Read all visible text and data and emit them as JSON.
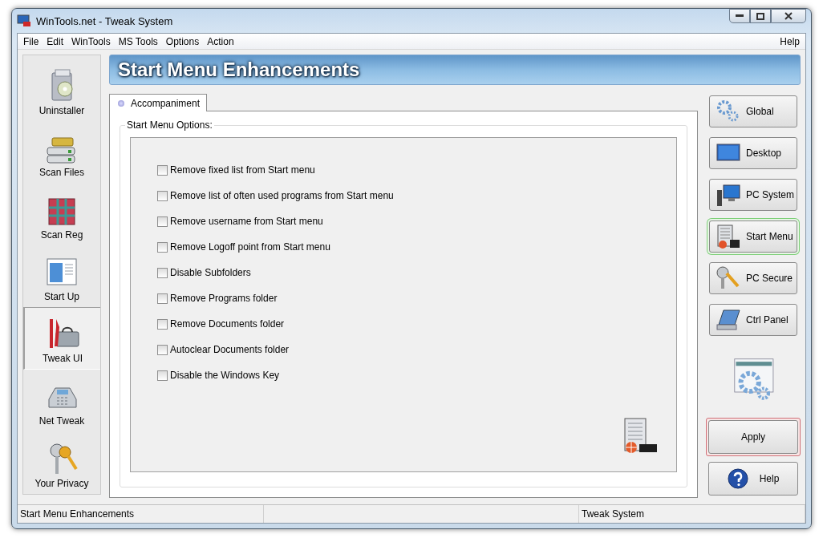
{
  "window": {
    "title": "WinTools.net - Tweak System"
  },
  "menu": [
    "File",
    "Edit",
    "WinTools",
    "MS Tools",
    "Options",
    "Action"
  ],
  "menu_right": "Help",
  "sidebar": [
    {
      "label": "Uninstaller",
      "selected": false
    },
    {
      "label": "Scan Files",
      "selected": false
    },
    {
      "label": "Scan Reg",
      "selected": false
    },
    {
      "label": "Start Up",
      "selected": false
    },
    {
      "label": "Tweak UI",
      "selected": true
    },
    {
      "label": "Net Tweak",
      "selected": false
    },
    {
      "label": "Your Privacy",
      "selected": false
    }
  ],
  "header": "Start Menu Enhancements",
  "tabs": [
    {
      "label": "Accompaniment",
      "selected": true
    }
  ],
  "group": {
    "title": "Start Menu Options:",
    "options": [
      {
        "label": "Remove fixed list from Start menu",
        "checked": false
      },
      {
        "label": "Remove list of often used programs from Start menu",
        "checked": false
      },
      {
        "label": "Remove username from Start menu",
        "checked": false
      },
      {
        "label": "Remove Logoff point from Start menu",
        "checked": false
      },
      {
        "label": "Disable Subfolders",
        "checked": false
      },
      {
        "label": "Remove Programs folder",
        "checked": false
      },
      {
        "label": "Remove Documents folder",
        "checked": false
      },
      {
        "label": "Autoclear Documents folder",
        "checked": false
      },
      {
        "label": "Disable the Windows Key",
        "checked": false
      }
    ]
  },
  "nav_buttons": [
    {
      "label": "Global",
      "selected": false
    },
    {
      "label": "Desktop",
      "selected": false
    },
    {
      "label": "PC System",
      "selected": false
    },
    {
      "label": "Start Menu",
      "selected": true
    },
    {
      "label": "PC Secure",
      "selected": false
    },
    {
      "label": "Ctrl Panel",
      "selected": false
    }
  ],
  "actions": [
    {
      "label": "Apply",
      "kind": "apply"
    },
    {
      "label": "Help",
      "kind": "help"
    }
  ],
  "status_bar": {
    "left": "Start Menu Enhancements",
    "right": "Tweak System"
  }
}
